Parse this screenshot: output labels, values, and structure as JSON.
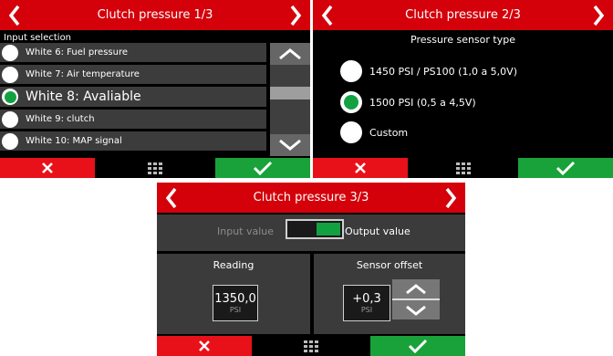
{
  "screen1": {
    "title": "Clutch pressure 1/3",
    "subheading": "Input selection",
    "items": [
      {
        "label": "White 6: Fuel pressure",
        "selected": false
      },
      {
        "label": "White 7: Air temperature",
        "selected": false
      },
      {
        "label": "White 8: Avaliable",
        "selected": true
      },
      {
        "label": "White 9:  clutch",
        "selected": false
      },
      {
        "label": "White 10: MAP signal",
        "selected": false
      }
    ]
  },
  "screen2": {
    "title": "Clutch pressure 2/3",
    "heading": "Pressure sensor type",
    "options": [
      {
        "label": "1450 PSI / PS100 (1,0 a 5,0V)",
        "selected": false
      },
      {
        "label": "1500 PSI (0,5 a 4,5V)",
        "selected": true
      },
      {
        "label": "Custom",
        "selected": false
      }
    ]
  },
  "screen3": {
    "title": "Clutch pressure 3/3",
    "input_label": "Input value",
    "output_label": "Output value",
    "reading": {
      "title": "Reading",
      "value": "1350,0",
      "unit": "PSI"
    },
    "offset": {
      "title": "Sensor offset",
      "value": "+0,3",
      "unit": "PSI"
    }
  },
  "colors": {
    "titlebar": "#d4000a",
    "cancel": "#e8111a",
    "confirm": "#19a23a",
    "selected": "#12a141"
  },
  "icons": [
    "chevron-left-icon",
    "chevron-right-icon",
    "close-icon",
    "grid-menu-icon",
    "checkmark-icon",
    "chevron-up-icon",
    "chevron-down-icon"
  ]
}
